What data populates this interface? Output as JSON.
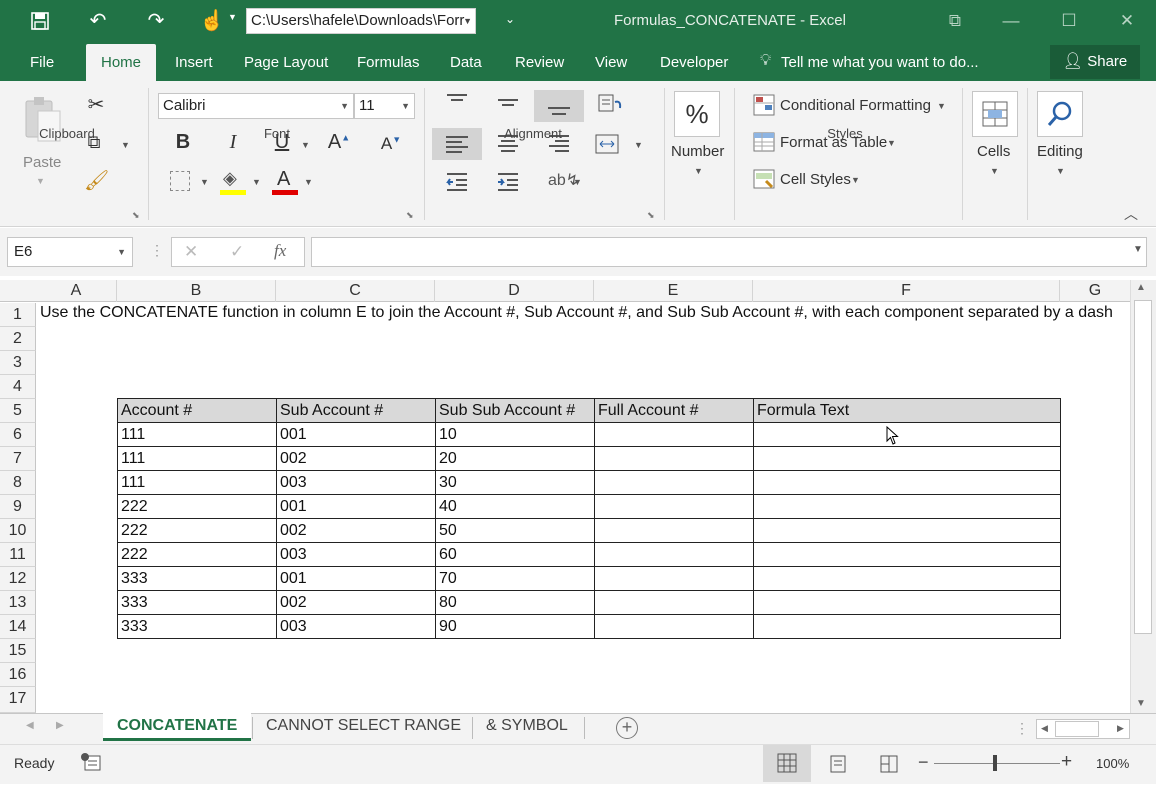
{
  "quick_access": {
    "path": "C:\\Users\\hafele\\Downloads\\Forr"
  },
  "window": {
    "title": "Formulas_CONCATENATE - Excel"
  },
  "ribbon_tabs": [
    "File",
    "Home",
    "Insert",
    "Page Layout",
    "Formulas",
    "Data",
    "Review",
    "View",
    "Developer"
  ],
  "tell_me": "Tell me what you want to do...",
  "share_label": "Share",
  "clipboard": {
    "paste_label": "Paste",
    "group_label": "Clipboard"
  },
  "font": {
    "name": "Calibri",
    "size": "11",
    "group_label": "Font",
    "bold": "B",
    "italic": "I",
    "underline": "U"
  },
  "alignment": {
    "group_label": "Alignment"
  },
  "number": {
    "label": "Number",
    "symbol": "%"
  },
  "styles": {
    "conditional_formatting": "Conditional Formatting",
    "format_as_table": "Format as Table",
    "cell_styles": "Cell Styles",
    "group_label": "Styles"
  },
  "cells": {
    "label": "Cells"
  },
  "editing": {
    "label": "Editing"
  },
  "formula_bar": {
    "name_box": "E6",
    "fx": "fx",
    "formula": ""
  },
  "columns": [
    "A",
    "B",
    "C",
    "D",
    "E",
    "F",
    "G"
  ],
  "rows": [
    "1",
    "2",
    "3",
    "4",
    "5",
    "6",
    "7",
    "8",
    "9",
    "10",
    "11",
    "12",
    "13",
    "14",
    "15",
    "16",
    "17"
  ],
  "instruction": "Use the CONCATENATE function in column E to join the Account #, Sub Account #, and Sub Sub Account #, with each component separated by a dash",
  "table": {
    "headers": [
      "Account #",
      "Sub Account #",
      "Sub Sub Account #",
      "Full Account #",
      "Formula Text"
    ],
    "rows": [
      [
        "111",
        "001",
        "10",
        "",
        ""
      ],
      [
        "111",
        "002",
        "20",
        "",
        ""
      ],
      [
        "111",
        "003",
        "30",
        "",
        ""
      ],
      [
        "222",
        "001",
        "40",
        "",
        ""
      ],
      [
        "222",
        "002",
        "50",
        "",
        ""
      ],
      [
        "222",
        "003",
        "60",
        "",
        ""
      ],
      [
        "333",
        "001",
        "70",
        "",
        ""
      ],
      [
        "333",
        "002",
        "80",
        "",
        ""
      ],
      [
        "333",
        "003",
        "90",
        "",
        ""
      ]
    ]
  },
  "sheet_tabs": [
    "CONCATENATE",
    "CANNOT SELECT RANGE",
    "& SYMBOL"
  ],
  "status": {
    "mode": "Ready",
    "zoom": "100%"
  },
  "colors": {
    "accent": "#217346",
    "header_fill": "#d9d9d9"
  }
}
